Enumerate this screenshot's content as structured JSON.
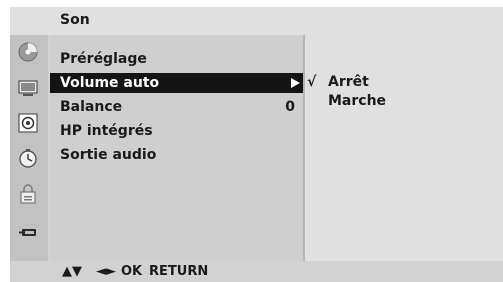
{
  "header": {
    "title": "Son"
  },
  "icons": [
    "picture-icon",
    "screen-icon",
    "speaker-icon",
    "clock-icon",
    "lock-icon",
    "input-icon"
  ],
  "menu": {
    "items": [
      {
        "label": "Préréglage",
        "value": ""
      },
      {
        "label": "Volume auto",
        "value": "",
        "selected": true
      },
      {
        "label": "Balance",
        "value": "0"
      },
      {
        "label": "HP intégrés",
        "value": ""
      },
      {
        "label": "Sortie audio",
        "value": ""
      }
    ]
  },
  "submenu": {
    "check_mark": "√",
    "options": [
      {
        "label": "Arrêt",
        "checked": true
      },
      {
        "label": "Marche",
        "checked": false
      }
    ]
  },
  "footer": {
    "nav_up_down": "▲▼",
    "nav_left_right": "◄►",
    "ok_label": "OK",
    "return_label": "RETURN"
  },
  "colors": {
    "highlight": "#141414",
    "highlight_text": "#ffffff",
    "panel": "#cfcfcf",
    "submenu": "#e0e0e0"
  }
}
